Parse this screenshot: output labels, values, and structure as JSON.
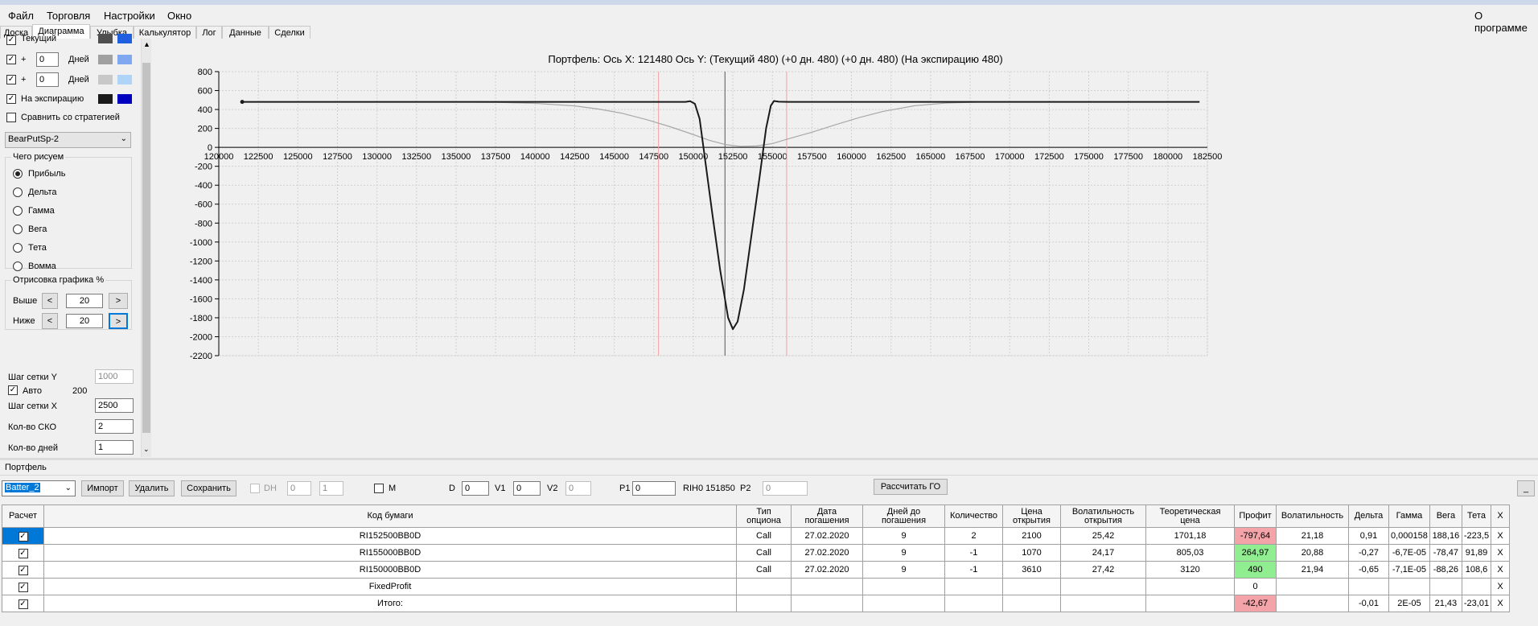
{
  "menu": {
    "items": [
      "Файл",
      "Торговля",
      "Настройки",
      "Окно"
    ],
    "about": "О программе"
  },
  "tabs": [
    "Доска",
    "Диаграмма",
    "Улыбка",
    "Калькулятор",
    "Лог",
    "Данные",
    "Сделки"
  ],
  "left": {
    "rows": [
      {
        "label": "Текущий",
        "checked": true,
        "colors": [
          "#4f4f4f",
          "#2060e0"
        ]
      },
      {
        "plus": "+",
        "value": "0",
        "unit": "Дней",
        "checked": true,
        "colors": [
          "#a0a0a0",
          "#7fa8f0"
        ]
      },
      {
        "plus": "+",
        "value": "0",
        "unit": "Дней",
        "checked": true,
        "colors": [
          "#c8c8c8",
          "#b0d4f8"
        ]
      },
      {
        "label": "На экспирацию",
        "checked": true,
        "colors": [
          "#1a1a1a",
          "#0000c0"
        ]
      }
    ],
    "compare_label": "Сравнить со стратегией",
    "strategy": "BearPutSp-2",
    "what_title": "Чего рисуем",
    "radios": [
      "Прибыль",
      "Дельта",
      "Гамма",
      "Вега",
      "Тета",
      "Вомма"
    ],
    "draw_title": "Отрисовка графика %",
    "above_label": "Выше",
    "above_value": "20",
    "below_label": "Ниже",
    "below_value": "20",
    "lt": "<",
    "gt": ">",
    "grid_y_label": "Шаг сетки Y",
    "grid_y_value": "1000",
    "auto_label": "Авто",
    "auto_value": "200",
    "grid_x_label": "Шаг сетки X",
    "grid_x_value": "2500",
    "sko_label": "Кол-во СКО",
    "sko_value": "2",
    "days_label": "Кол-во дней",
    "days_value": "1"
  },
  "chart_data": {
    "type": "line",
    "title": "Портфель:  Ось X:  121480  Ось Y:   (Текущий 480)   (+0 дн. 480)   (+0 дн. 480)   (На экспирацию 480)",
    "xlim": [
      120000,
      182500
    ],
    "ylim": [
      -2200,
      800
    ],
    "x_ticks": [
      120000,
      122500,
      125000,
      127500,
      130000,
      132500,
      135000,
      137500,
      140000,
      142500,
      145000,
      147500,
      150000,
      152500,
      155000,
      157500,
      160000,
      162500,
      165000,
      167500,
      170000,
      172500,
      175000,
      177500,
      180000,
      182500
    ],
    "y_ticks": [
      800,
      600,
      400,
      200,
      0,
      -200,
      -400,
      -600,
      -800,
      -1000,
      -1200,
      -1400,
      -1600,
      -1800,
      -2000,
      -2200
    ],
    "vlines": [
      {
        "x": 152000,
        "color": "#555555"
      },
      {
        "x": 147800,
        "color": "#f4a0a0"
      },
      {
        "x": 155900,
        "color": "#f4a0a0"
      }
    ],
    "series": [
      {
        "color": "#a8a8a8",
        "x": [
          121480,
          135000,
          137500,
          140000,
          142500,
          144000,
          145500,
          147000,
          148500,
          150000,
          151000,
          152000,
          153000,
          154000,
          155000,
          156000,
          157500,
          159000,
          160500,
          162000,
          164000,
          166000,
          168000,
          182000
        ],
        "y": [
          480,
          479,
          476,
          465,
          438,
          405,
          360,
          295,
          220,
          135,
          75,
          30,
          10,
          15,
          40,
          90,
          160,
          240,
          315,
          380,
          440,
          468,
          478,
          480
        ]
      },
      {
        "color": "#1a1a1a",
        "x": [
          121480,
          149500,
          149800,
          150100,
          150400,
          150800,
          151200,
          151700,
          152200,
          152500,
          152800,
          153200,
          153700,
          154200,
          154600,
          154900,
          155100,
          155400,
          156000,
          182000
        ],
        "y": [
          480,
          480,
          488,
          460,
          300,
          -200,
          -700,
          -1300,
          -1800,
          -1920,
          -1840,
          -1500,
          -900,
          -300,
          200,
          440,
          490,
          482,
          480,
          480
        ]
      }
    ]
  },
  "portfolio": {
    "title": "Портфель",
    "name": "Batter_2",
    "import": "Импорт",
    "delete": "Удалить",
    "save": "Сохранить",
    "dh": "DH",
    "dh_a": "0",
    "dh_b": "1",
    "m": "M",
    "d": "D",
    "d_val": "0",
    "v1": "V1",
    "v1_val": "0",
    "v2": "V2",
    "v2_val": "0",
    "p1": "P1",
    "p1_val": "0",
    "rih": "RIH0 151850",
    "p2": "P2",
    "p2_val": "0",
    "calc": "Рассчитать ГО",
    "min": "_"
  },
  "table": {
    "headers": [
      "Расчет",
      "Код бумаги",
      "Тип\nопциона",
      "Дата\nпогашения",
      "Дней до\nпогашения",
      "Количество",
      "Цена\nоткрытия",
      "Волатильность\nоткрытия",
      "Теоретическая\nцена",
      "Профит",
      "Волатильность",
      "Дельта",
      "Гамма",
      "Вега",
      "Тета",
      "X"
    ],
    "rows": [
      [
        "",
        "RI152500BB0D",
        "Call",
        "27.02.2020",
        "9",
        "2",
        "2100",
        "25,42",
        "1701,18",
        "-797,64",
        "21,18",
        "0,91",
        "0,000158",
        "188,16",
        "-223,5",
        "X"
      ],
      [
        "",
        "RI155000BB0D",
        "Call",
        "27.02.2020",
        "9",
        "-1",
        "1070",
        "24,17",
        "805,03",
        "264,97",
        "20,88",
        "-0,27",
        "-6,7E-05",
        "-78,47",
        "91,89",
        "X"
      ],
      [
        "",
        "RI150000BB0D",
        "Call",
        "27.02.2020",
        "9",
        "-1",
        "3610",
        "27,42",
        "3120",
        "490",
        "21,94",
        "-0,65",
        "-7,1E-05",
        "-88,26",
        "108,6",
        "X"
      ],
      [
        "",
        "FixedProfit",
        "",
        "",
        "",
        "",
        "",
        "",
        "",
        "0",
        "",
        "",
        "",
        "",
        "",
        "X"
      ],
      [
        "",
        "Итого:",
        "",
        "",
        "",
        "",
        "",
        "",
        "",
        "-42,67",
        "",
        "-0,01",
        "2E-05",
        "21,43",
        "-23,01",
        "X"
      ]
    ],
    "profit_colors": [
      "neg",
      "pos",
      "pos",
      "",
      "neg"
    ]
  }
}
